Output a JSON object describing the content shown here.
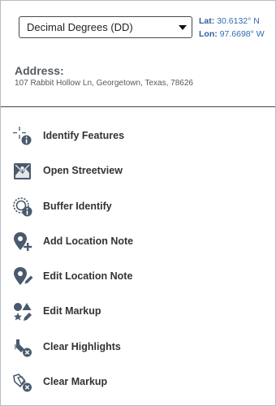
{
  "coordinates": {
    "format_selected": "Decimal Degrees (DD)",
    "lat_label": "Lat:",
    "lat_value": "30.6132° N",
    "lon_label": "Lon:",
    "lon_value": "97.6698° W"
  },
  "address": {
    "title": "Address:",
    "text": "107 Rabbit Hollow Ln, Georgetown, Texas, 78626"
  },
  "menu": {
    "items": [
      {
        "label": "Identify Features",
        "icon": "identify-features-icon"
      },
      {
        "label": "Open Streetview",
        "icon": "streetview-icon"
      },
      {
        "label": "Buffer Identify",
        "icon": "buffer-identify-icon"
      },
      {
        "label": "Add Location Note",
        "icon": "add-location-note-icon"
      },
      {
        "label": "Edit Location Note",
        "icon": "edit-location-note-icon"
      },
      {
        "label": "Edit Markup",
        "icon": "edit-markup-icon"
      },
      {
        "label": "Clear Highlights",
        "icon": "clear-highlights-icon"
      },
      {
        "label": "Clear Markup",
        "icon": "clear-markup-icon"
      }
    ]
  },
  "colors": {
    "icon": "#4a5a6e",
    "link_blue": "#2e6cb5",
    "text": "#333333"
  }
}
